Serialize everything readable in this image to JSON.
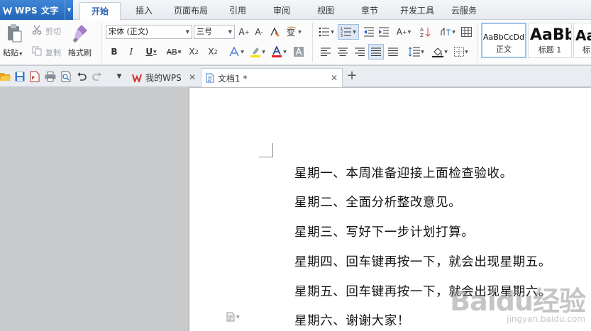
{
  "app": {
    "title": "WPS 文字",
    "logo": "wps-w-icon"
  },
  "menu_tabs": [
    {
      "label": "开始",
      "active": true
    },
    {
      "label": "插入"
    },
    {
      "label": "页面布局"
    },
    {
      "label": "引用"
    },
    {
      "label": "审阅"
    },
    {
      "label": "视图"
    },
    {
      "label": "章节"
    },
    {
      "label": "开发工具"
    },
    {
      "label": "云服务"
    }
  ],
  "ribbon": {
    "paste": "粘贴",
    "cut": "剪切",
    "copy": "复制",
    "format_painter": "格式刷",
    "font_name": "宋体 (正文)",
    "font_size": "三号",
    "styles": [
      {
        "sample": "AaBbCcDd",
        "name": "正文"
      },
      {
        "sample": "AaBb",
        "name": "标题 1"
      },
      {
        "sample": "Aa",
        "name": "标"
      }
    ]
  },
  "doc_tabs": [
    {
      "label": "我的WPS"
    },
    {
      "label": "文档1 *",
      "active": true
    }
  ],
  "document": {
    "lines": [
      "星期一、本周准备迎接上面检查验收。",
      "星期二、全面分析整改意见。",
      "星期三、写好下一步计划打算。",
      "星期四、回车键再按一下，就会出现星期五。",
      "星期五、回车键再按一下，就会出现星期六。",
      "星期六、谢谢大家！"
    ]
  },
  "watermark": {
    "main": "Baidu经验",
    "sub": "jingyan.baidu.com"
  },
  "colors": {
    "accent": "#2a66b8",
    "font_color": "#e02020",
    "highlight": "#f7e200"
  }
}
